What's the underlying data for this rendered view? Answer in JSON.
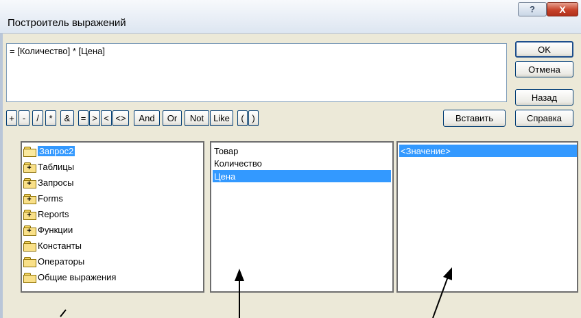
{
  "window": {
    "title": "Построитель выражений",
    "help_glyph": "?",
    "close_glyph": "X"
  },
  "expression": {
    "value": "= [Количество] * [Цена]"
  },
  "buttons": {
    "ok": "OK",
    "cancel": "Отмена",
    "back": "Назад",
    "insert": "Вставить",
    "help": "Справка"
  },
  "operators": [
    "+",
    "-",
    "/",
    "*",
    "&",
    "=",
    ">",
    "<",
    "<>",
    "And",
    "Or",
    "Not",
    "Like",
    "(",
    ")"
  ],
  "tree": {
    "items": [
      {
        "label": "Запрос2",
        "icon": "open-folder-icon",
        "selected": true
      },
      {
        "label": "Таблицы",
        "icon": "folder-plus-icon"
      },
      {
        "label": "Запросы",
        "icon": "folder-plus-icon"
      },
      {
        "label": "Forms",
        "icon": "folder-plus-icon"
      },
      {
        "label": "Reports",
        "icon": "folder-plus-icon"
      },
      {
        "label": "Функции",
        "icon": "folder-plus-icon"
      },
      {
        "label": "Константы",
        "icon": "folder-icon"
      },
      {
        "label": "Операторы",
        "icon": "folder-icon"
      },
      {
        "label": "Общие выражения",
        "icon": "folder-icon"
      }
    ]
  },
  "fields": {
    "items": [
      "Товар",
      "Количество",
      "Цена"
    ],
    "selected": "Цена"
  },
  "values": {
    "items": [
      "<Значение>"
    ],
    "selected": "<Значение>"
  },
  "colors": {
    "selection": "#3399ff",
    "dialog_face": "#ece9d8",
    "close_button": "#c7432a"
  }
}
